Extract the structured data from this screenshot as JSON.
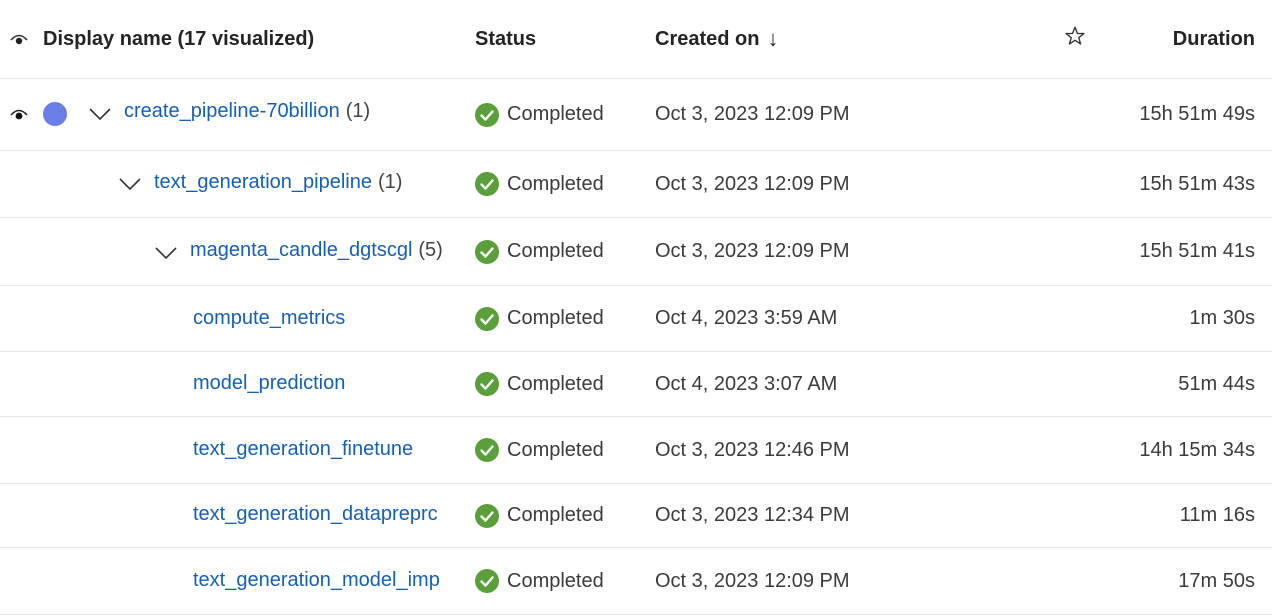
{
  "header": {
    "display_name_label": "Display name (17 visualized)",
    "status_label": "Status",
    "created_label": "Created on",
    "sort_icon": "arrow-down-icon",
    "star_icon": "star-outline-icon",
    "duration_label": "Duration"
  },
  "colors": {
    "link": "#1560b7",
    "success": "#5b9f3a",
    "series_dot": "#6b7de8"
  },
  "rows": [
    {
      "name": "create_pipeline-70billion",
      "count": "(1)",
      "status": "Completed",
      "created": "Oct 3, 2023 12:09 PM",
      "duration": "15h 51m 49s"
    },
    {
      "name": "text_generation_pipeline",
      "count": "(1)",
      "status": "Completed",
      "created": "Oct 3, 2023 12:09 PM",
      "duration": "15h 51m 43s"
    },
    {
      "name": "magenta_candle_dgtscgl",
      "count": "(5)",
      "status": "Completed",
      "created": "Oct 3, 2023 12:09 PM",
      "duration": "15h 51m 41s"
    },
    {
      "name": "compute_metrics",
      "count": "",
      "status": "Completed",
      "created": "Oct 4, 2023 3:59 AM",
      "duration": "1m 30s"
    },
    {
      "name": "model_prediction",
      "count": "",
      "status": "Completed",
      "created": "Oct 4, 2023 3:07 AM",
      "duration": "51m 44s"
    },
    {
      "name": "text_generation_finetune",
      "count": "",
      "status": "Completed",
      "created": "Oct 3, 2023 12:46 PM",
      "duration": "14h 15m 34s"
    },
    {
      "name": "text_generation_datapreprc",
      "count": "",
      "status": "Completed",
      "created": "Oct 3, 2023 12:34 PM",
      "duration": "11m 16s"
    },
    {
      "name": "text_generation_model_imp",
      "count": "",
      "status": "Completed",
      "created": "Oct 3, 2023 12:09 PM",
      "duration": "17m 50s"
    }
  ]
}
